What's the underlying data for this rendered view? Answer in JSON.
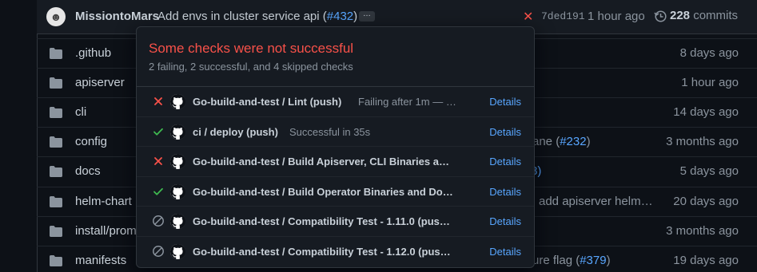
{
  "commit": {
    "author": "MissiontoMars",
    "message": "Add envs in cluster service api (",
    "pr": "#432",
    "message_end": ")",
    "ellipsis": "…",
    "status": "✕",
    "sha": "7ded191",
    "time": "1 hour ago",
    "commit_count": "228",
    "commits_label": "commits"
  },
  "files": [
    {
      "name": ".github",
      "msg": "",
      "link": "",
      "msg_end": "",
      "date": "8 days ago"
    },
    {
      "name": "apiserver",
      "msg": "",
      "link": "",
      "msg_end": "",
      "date": "1 hour ago"
    },
    {
      "name": "cli",
      "msg": "",
      "link": "",
      "msg_end": "",
      "date": "14 days ago"
    },
    {
      "name": "config",
      "msg": "ane (",
      "link": "#232",
      "msg_end": ")",
      "date": "3 months ago"
    },
    {
      "name": "docs",
      "msg": "",
      "link": "8)",
      "msg_end": "",
      "date": "5 days ago"
    },
    {
      "name": "helm-chart",
      "msg": "add apiserver helm…",
      "link": "",
      "msg_end": "",
      "date": "20 days ago"
    },
    {
      "name": "install/prom",
      "msg": ")",
      "link": "",
      "msg_end": "",
      "date": "3 months ago"
    },
    {
      "name": "manifests",
      "msg": "ure flag (",
      "link": "#379",
      "msg_end": ")",
      "date": "19 days ago"
    }
  ],
  "popup": {
    "title": "Some checks were not successful",
    "subtitle": "2 failing, 2 successful, and 4 skipped checks",
    "checks": [
      {
        "status": "failing",
        "name": "Go-build-and-test / Lint (push)",
        "desc": "Failing after 1m — …",
        "details": "Details"
      },
      {
        "status": "success",
        "name": "ci / deploy (push)",
        "desc": "Successful in 35s",
        "details": "Details"
      },
      {
        "status": "failing",
        "name": "Go-build-and-test / Build Apiserver, CLI Binaries a…",
        "desc": "",
        "details": "Details"
      },
      {
        "status": "success",
        "name": "Go-build-and-test / Build Operator Binaries and Do…",
        "desc": "",
        "details": "Details"
      },
      {
        "status": "skipped",
        "name": "Go-build-and-test / Compatibility Test - 1.11.0 (pus…",
        "desc": "",
        "details": "Details"
      },
      {
        "status": "skipped",
        "name": "Go-build-and-test / Compatibility Test - 1.12.0 (pus…",
        "desc": "",
        "details": "Details"
      }
    ]
  },
  "colors": {
    "failing": "#f85149",
    "success": "#3fb950",
    "skipped": "#8b949e",
    "link": "#58a6ff"
  }
}
